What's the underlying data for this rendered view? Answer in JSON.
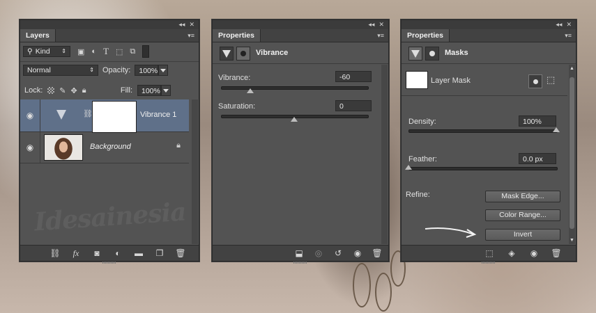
{
  "layers_panel": {
    "tab_label": "Layers",
    "filter_kind": "Kind",
    "blend_mode": "Normal",
    "opacity_label": "Opacity:",
    "opacity_value": "100%",
    "lock_label": "Lock:",
    "fill_label": "Fill:",
    "fill_value": "100%",
    "layers": [
      {
        "name": "Vibrance 1",
        "type": "adjustment",
        "selected": true
      },
      {
        "name": "Background",
        "type": "image",
        "locked": true
      }
    ],
    "watermark": "Idesainesia"
  },
  "vibrance_panel": {
    "tab_label": "Properties",
    "heading": "Vibrance",
    "vibrance_label": "Vibrance:",
    "vibrance_value": "-60",
    "vibrance_level_pct": 20,
    "saturation_label": "Saturation:",
    "saturation_value": "0",
    "saturation_level_pct": 50
  },
  "masks_panel": {
    "tab_label": "Properties",
    "heading": "Masks",
    "layer_mask_label": "Layer Mask",
    "density_label": "Density:",
    "density_value": "100%",
    "density_level_pct": 100,
    "feather_label": "Feather:",
    "feather_value": "0.0 px",
    "feather_level_pct": 0,
    "refine_label": "Refine:",
    "mask_edge_button": "Mask Edge...",
    "color_range_button": "Color Range...",
    "invert_button": "Invert"
  }
}
